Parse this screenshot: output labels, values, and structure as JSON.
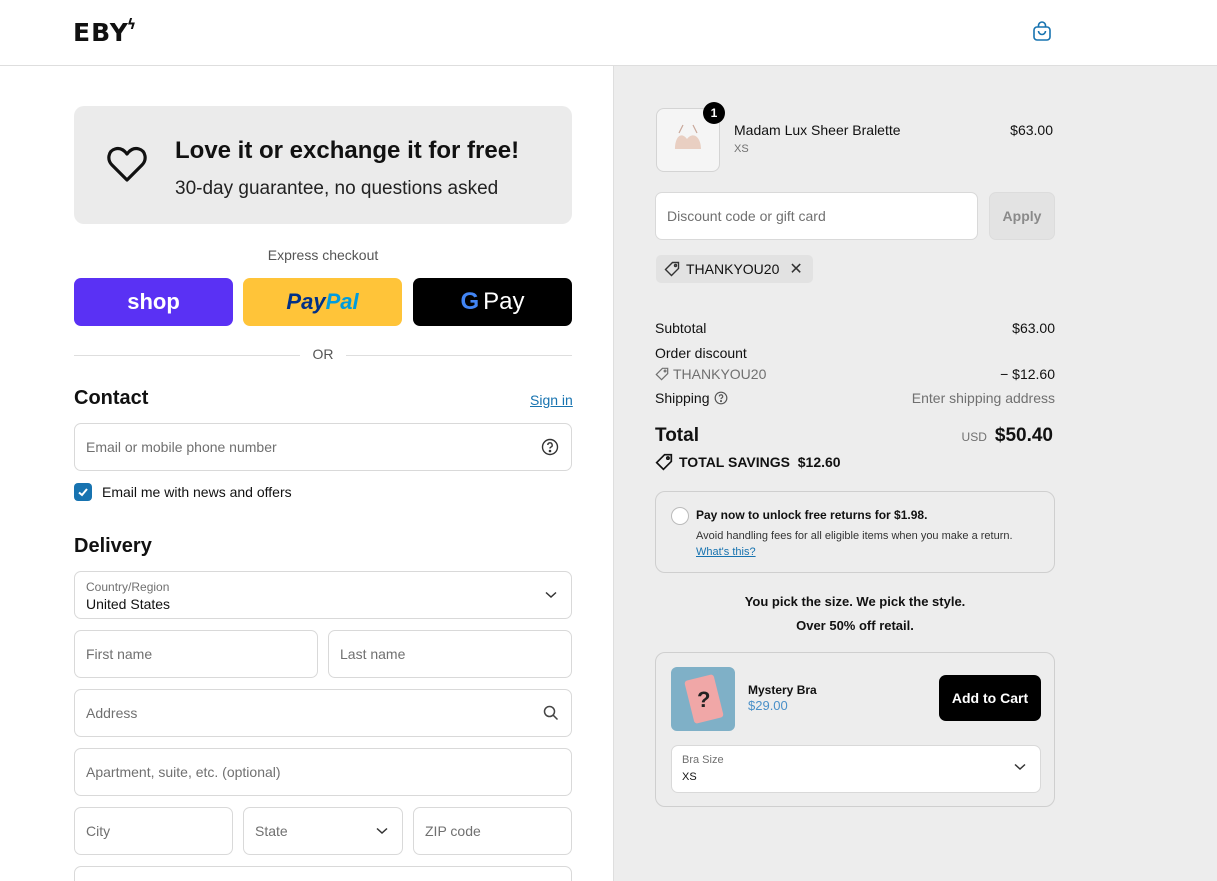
{
  "header": {
    "logo": "EBY",
    "logo_mark": "ϟ"
  },
  "guarantee": {
    "title": "Love it or exchange it for free!",
    "subtitle": "30-day guarantee, no questions asked"
  },
  "express": {
    "label": "Express checkout",
    "shop_label": "shop",
    "paypal_part1": "Pay",
    "paypal_part2": "Pal",
    "gpay_g": "G",
    "gpay_label": "Pay"
  },
  "divider": {
    "or": "OR"
  },
  "contact": {
    "title": "Contact",
    "signin": "Sign in",
    "email_placeholder": "Email or mobile phone number",
    "newsletter_label": "Email me with news and offers",
    "newsletter_checked": true
  },
  "delivery": {
    "title": "Delivery",
    "country_label": "Country/Region",
    "country_value": "United States",
    "first_name": "First name",
    "last_name": "Last name",
    "address": "Address",
    "apartment": "Apartment, suite, etc. (optional)",
    "city": "City",
    "state": "State",
    "zip": "ZIP code"
  },
  "cart": {
    "item": {
      "quantity": "1",
      "name": "Madam Lux Sheer Bralette",
      "variant": "XS",
      "price": "$63.00"
    },
    "discount_placeholder": "Discount code or gift card",
    "apply_label": "Apply",
    "applied_code": "THANKYOU20"
  },
  "summary": {
    "subtotal_label": "Subtotal",
    "subtotal_value": "$63.00",
    "order_discount_label": "Order discount",
    "discount_code": "THANKYOU20",
    "discount_value": "− $12.60",
    "shipping_label": "Shipping",
    "shipping_value": "Enter shipping address",
    "total_label": "Total",
    "currency": "USD",
    "total_value": "$50.40",
    "savings_label": "TOTAL SAVINGS",
    "savings_value": "$12.60"
  },
  "returns": {
    "title": "Pay now to unlock free returns for $1.98.",
    "description": "Avoid handling fees for all eligible items when you make a return.",
    "link": "What's this?"
  },
  "upsell": {
    "line1": "You pick the size. We pick the style.",
    "line2": "Over 50% off retail.",
    "name": "Mystery Bra",
    "price": "$29.00",
    "add_label": "Add to Cart",
    "size_label": "Bra Size",
    "size_value": "XS"
  },
  "colors": {
    "shop_purple": "#5a31f4",
    "paypal_yellow": "#ffc439",
    "link_blue": "#1773b0",
    "summary_bg": "#ededed"
  }
}
